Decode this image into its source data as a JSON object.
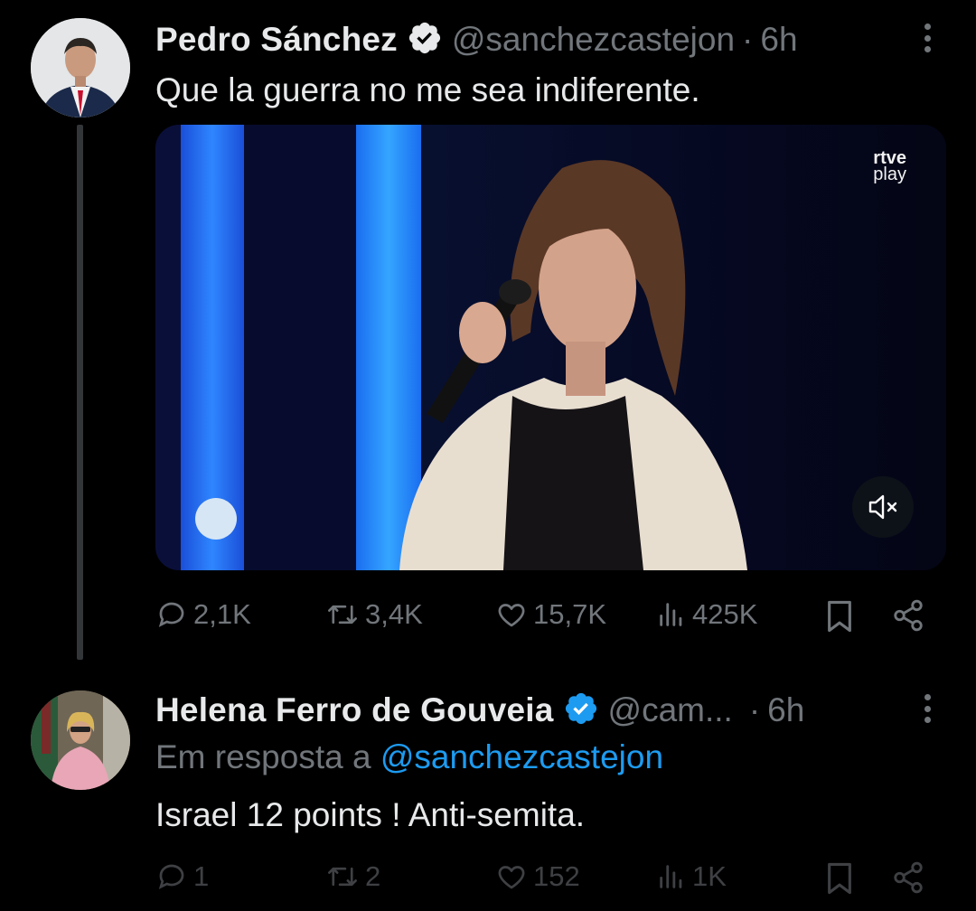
{
  "tweets": [
    {
      "name": "Pedro Sánchez",
      "handle": "@sanchezcastejon",
      "separator": "·",
      "time": "6h",
      "text": "Que la guerra no me sea indiferente.",
      "media": {
        "watermark_line1": "rtve",
        "watermark_line2": "play"
      },
      "metrics": {
        "replies": "2,1K",
        "reposts": "3,4K",
        "likes": "15,7K",
        "views": "425K"
      }
    },
    {
      "name": "Helena Ferro de Gouveia",
      "handle": "@cam...",
      "separator": "·",
      "time": "6h",
      "reply_prefix": "Em resposta a",
      "reply_to": "@sanchezcastejon",
      "text": "Israel 12 points ! Anti-semita.",
      "metrics": {
        "replies": "1",
        "reposts": "2",
        "likes": "152",
        "views": "1K"
      }
    }
  ],
  "colors": {
    "background": "#000000",
    "text": "#e7e9ea",
    "muted": "#71767b",
    "link": "#1d9bf0",
    "verified": "#1d9bf0"
  },
  "icons": [
    "verified-badge-icon",
    "more-icon",
    "reply-icon",
    "repost-icon",
    "like-icon",
    "views-icon",
    "bookmark-icon",
    "share-icon",
    "mute-icon"
  ]
}
